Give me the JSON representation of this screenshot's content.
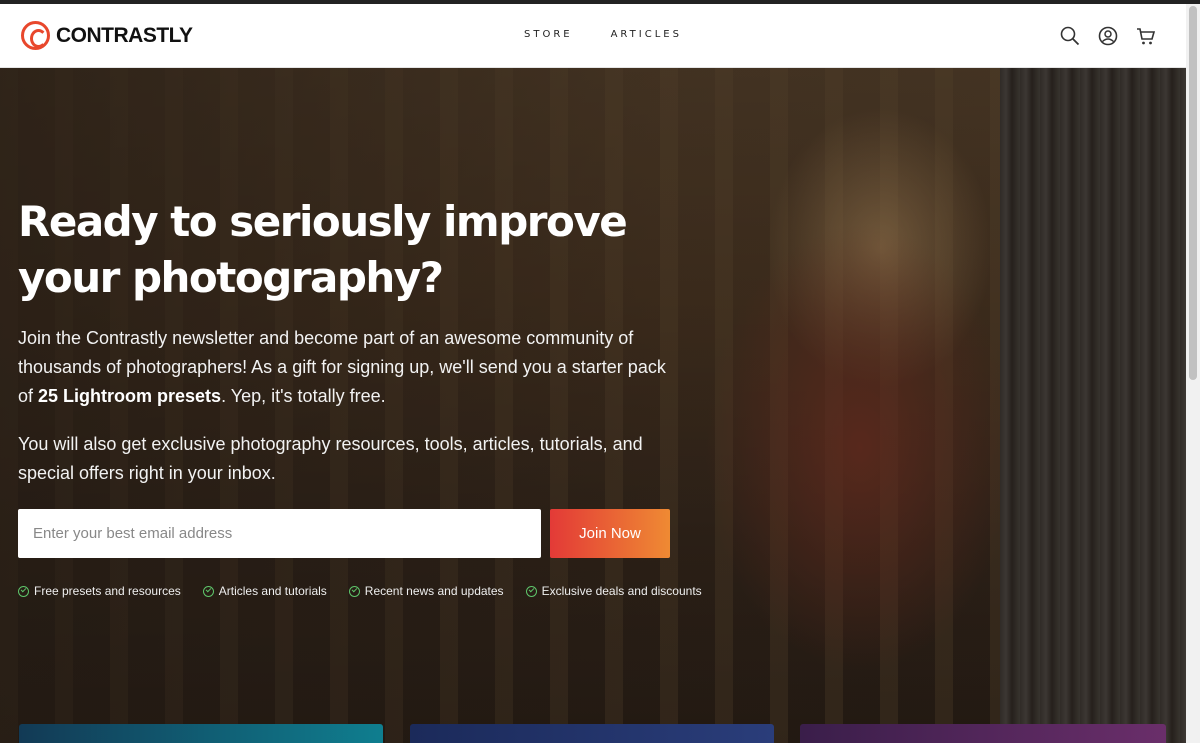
{
  "brand": {
    "name": "CONTRASTLY",
    "accent": "#e8472c"
  },
  "nav": [
    {
      "label": "STORE"
    },
    {
      "label": "ARTICLES"
    }
  ],
  "header_icons": [
    "search-icon",
    "account-icon",
    "cart-icon"
  ],
  "hero": {
    "headline": "Ready to seriously improve your photography?",
    "para1_start": "Join the Contrastly newsletter and become part of an awesome community of thousands of photographers! As a gift for signing up, we'll send you a starter pack of ",
    "para1_bold": "25 Lightroom presets",
    "para1_end": ". Yep, it's totally free.",
    "para2": "You will also get exclusive photography resources, tools, articles, tutorials, and special offers right in your inbox.",
    "email_placeholder": "Enter your best email address",
    "join_label": "Join Now",
    "perks": [
      "Free presets and resources",
      "Articles and tutorials",
      "Recent news and updates",
      "Exclusive deals and discounts"
    ]
  }
}
